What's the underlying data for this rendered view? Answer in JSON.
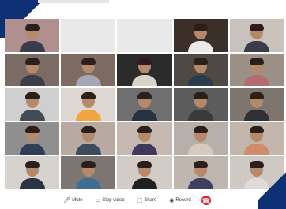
{
  "header": {
    "title": ""
  },
  "grid": {
    "tiles": [
      {
        "name": "",
        "center_label": "",
        "bg": "#b08f8f",
        "shirt": "#3a3c4a",
        "person": true
      },
      {
        "name": "",
        "center_label": "",
        "bg": "#e9e9e9",
        "shirt": "#000000",
        "person": false
      },
      {
        "name": "",
        "center_label": "",
        "bg": "#e9e9e9",
        "shirt": "#000000",
        "person": false
      },
      {
        "name": "",
        "center_label": "",
        "bg": "#3b2f2a",
        "shirt": "#e9e9e9",
        "person": true
      },
      {
        "name": "",
        "center_label": "",
        "bg": "#c9c1bb",
        "shirt": "#3a3c4a",
        "person": true
      },
      {
        "name": "",
        "center_label": "",
        "bg": "#7a6b64",
        "shirt": "#3c3d45",
        "person": true
      },
      {
        "name": "",
        "center_label": "",
        "bg": "#7d6a60",
        "shirt": "#a5a8b4",
        "person": true
      },
      {
        "name": "",
        "center_label": "",
        "bg": "#2b2b2b",
        "shirt": "#d9d2c8",
        "person": true
      },
      {
        "name": "",
        "center_label": "",
        "bg": "#4e4a43",
        "shirt": "#2a3b4e",
        "person": true
      },
      {
        "name": "",
        "center_label": "",
        "bg": "#9b8f86",
        "shirt": "#b36d6f",
        "person": true
      },
      {
        "name": "",
        "center_label": "",
        "bg": "#cfcfd0",
        "shirt": "#444b55",
        "person": true
      },
      {
        "name": "",
        "center_label": "",
        "bg": "#ded7d1",
        "shirt": "#f1a43f",
        "person": true
      },
      {
        "name": "",
        "center_label": "",
        "bg": "#6f6f70",
        "shirt": "#27313f",
        "person": true
      },
      {
        "name": "",
        "center_label": "",
        "bg": "#5c5c5d",
        "shirt": "#3a3a3a",
        "person": true
      },
      {
        "name": "",
        "center_label": "",
        "bg": "#7f756f",
        "shirt": "#2f2f34",
        "person": true
      },
      {
        "name": "",
        "center_label": "",
        "bg": "#8f8f8f",
        "shirt": "#2f3e58",
        "person": true
      },
      {
        "name": "",
        "center_label": "",
        "bg": "#b8a9a2",
        "shirt": "#3d4b5f",
        "person": true
      },
      {
        "name": "",
        "center_label": "",
        "bg": "#c5b9b2",
        "shirt": "#3f3a5c",
        "person": true
      },
      {
        "name": "",
        "center_label": "",
        "bg": "#b7b0aa",
        "shirt": "#d6c9c0",
        "person": true
      },
      {
        "name": "",
        "center_label": "",
        "bg": "#c2b6ad",
        "shirt": "#d08b6b",
        "person": true
      },
      {
        "name": "",
        "center_label": "",
        "bg": "#d6d2ce",
        "shirt": "#2e3246",
        "person": true
      },
      {
        "name": "",
        "center_label": "",
        "bg": "#7d7571",
        "shirt": "#3d6f95",
        "person": true
      },
      {
        "name": "",
        "center_label": "",
        "bg": "#d2cbc6",
        "shirt": "#1f2022",
        "person": true
      },
      {
        "name": "",
        "center_label": "",
        "bg": "#bfb6b0",
        "shirt": "#3c4062",
        "person": true
      },
      {
        "name": "",
        "center_label": "",
        "bg": "#cfc9c4",
        "shirt": "#e0dada",
        "person": true
      }
    ]
  },
  "controls": {
    "mute_label": "Mute",
    "video_label": "Stop video",
    "share_label": "Share",
    "record_label": "Record"
  },
  "colors": {
    "accent": "#0d2f73",
    "end_call": "#e3232b"
  },
  "icons": {
    "mute": "microphone-icon",
    "video": "video-camera-icon",
    "share": "share-screen-icon",
    "record": "record-icon",
    "end": "phone-end-icon"
  }
}
